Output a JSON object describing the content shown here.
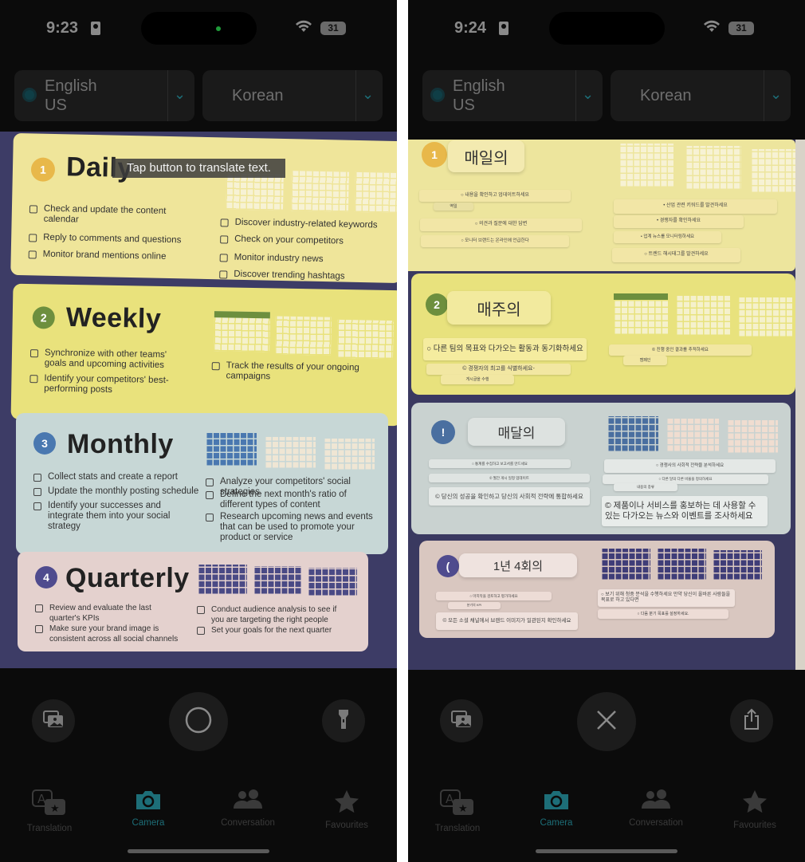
{
  "left": {
    "status": {
      "time": "9:23",
      "battery": "31"
    },
    "source_lang": {
      "name": "English",
      "region": "US"
    },
    "target_lang": {
      "name": "Korean"
    },
    "tooltip": "Tap button to translate text.",
    "poster": {
      "daily": {
        "num": "1",
        "title": "Daily",
        "items_left": [
          "Check and update the content calendar",
          "Reply to comments and questions",
          "Monitor brand mentions online"
        ],
        "items_right": [
          "Discover industry-related keywords",
          "Check on your competitors",
          "Monitor industry news",
          "Discover trending hashtags"
        ]
      },
      "weekly": {
        "num": "2",
        "title": "Weekly",
        "items_left": [
          "Synchronize with other teams' goals and upcoming activities",
          "Identify your competitors' best-performing posts"
        ],
        "items_right": [
          "Track the results of your ongoing campaigns"
        ]
      },
      "monthly": {
        "num": "3",
        "title": "Monthly",
        "items_left": [
          "Collect stats and create a report",
          "Update the monthly posting schedule",
          "Identify your successes and integrate them into your social strategy"
        ],
        "items_right": [
          "Analyze your competitors' social strategies",
          "Define the next month's ratio of different types of content",
          "Research upcoming news and events that can be used to promote your product or service"
        ]
      },
      "quarterly": {
        "num": "4",
        "title": "Quarterly",
        "items_left": [
          "Review and evaluate the last quarter's KPIs",
          "Make sure your brand image is consistent across all social channels"
        ],
        "items_right": [
          "Conduct audience analysis to see if you are targeting the right people",
          "Set your goals for the next quarter"
        ]
      }
    },
    "controls": {
      "left": "photo-library-icon",
      "center": "shutter-icon",
      "right": "flashlight-icon"
    }
  },
  "right": {
    "status": {
      "time": "9:24",
      "battery": "31"
    },
    "source_lang": {
      "name": "English",
      "region": "US"
    },
    "target_lang": {
      "name": "Korean"
    },
    "translated": {
      "daily": {
        "num": "1",
        "title": "매일의",
        "overlays": [
          "○ 내용을 확인하고 업데이트하세요",
          "역일",
          "○ 의견과 질문에 대한 답변",
          "○ 모니터 브랜드는 온라인에 언급한다",
          "• 산업 관련 키워드를 발견하세요",
          "• 경쟁자를 확인하세요",
          "• 업계 뉴스를 모니터링하세요",
          "○ 트렌드 해시태그를 발견하세요"
        ]
      },
      "weekly": {
        "num": "2",
        "title": "매주의",
        "overlays": [
          "○ 다른 팀의 목표와 다가오는 활동과 동기화하세요",
          "© 경쟁자의 최고를 식별하세요-",
          "게시글을 수행",
          "© 진행 중인 결과를 추적하세요",
          "캠페인"
        ]
      },
      "monthly": {
        "num": "!",
        "title": "매달의",
        "overlays": [
          "○ 통계를 수집하고 보고서를 만드세요",
          "© 월간 게시 일정 업데이트",
          "© 당신의 성공을 확인하고 당신의 사회적 전략에 통합하세요",
          "○ 경쟁사의 사회적 전략을 분석하세요",
          "○ 다른 달의 다른 비율을 정의하세요",
          "내용의 종류",
          "© 제품이나 서비스를 홍보하는 데 사용할 수 있는 다가오는 뉴스와 이벤트를 조사하세요"
        ]
      },
      "quarterly": {
        "num": "(",
        "title": "1년 4회의",
        "overlays": [
          "○ 마지막을 검토하고 평가하세요",
          "분기의 KPI",
          "© 모든 소셜 채널에서 브랜드 이미지가 일관된지 확인하세요",
          "○ 보기 위해 청중 분석을 수행하세요 만약 당신이 올바른 사람들을 목표로 하고 있다면",
          "○ 다음 분기 목표를 설정하세요."
        ]
      }
    },
    "controls": {
      "left": "photo-library-icon",
      "center": "close-icon",
      "right": "share-icon"
    }
  },
  "tabs": [
    {
      "label": "Translation",
      "icon": "translation-icon"
    },
    {
      "label": "Camera",
      "icon": "camera-icon",
      "active": true
    },
    {
      "label": "Conversation",
      "icon": "conversation-icon"
    },
    {
      "label": "Favourites",
      "icon": "star-icon"
    }
  ],
  "colors": {
    "accent": "#1d6e78",
    "daily": "#e8b84a",
    "weekly": "#6d8f3e",
    "monthly": "#4a78b0",
    "quarterly": "#4f4b8e",
    "poster_bg": "#3d3c66"
  }
}
